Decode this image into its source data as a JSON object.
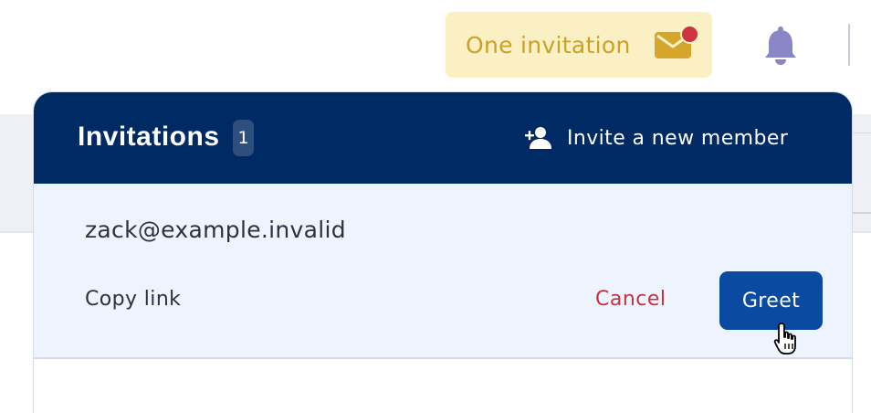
{
  "topbar": {
    "invitation_chip_label": "One invitation",
    "icons": [
      "mail-icon",
      "notification-dot",
      "bell-icon"
    ],
    "chip_color": "#fbefc4",
    "chip_text_color": "#c9a227",
    "dot_color": "#d0323f",
    "bell_color": "#8b86c6"
  },
  "popup": {
    "title": "Invitations",
    "count": "1",
    "invite_new_label": "Invite a new member",
    "invite_new_icon": "add-user-icon",
    "header_color": "#002a64",
    "row_color": "#eef4fd",
    "invitation": {
      "email": "zack@example.invalid",
      "copy_link_label": "Copy link",
      "cancel_label": "Cancel",
      "greet_label": "Greet"
    },
    "accent_color": "#0a4aa0",
    "danger_color": "#c9303d"
  }
}
